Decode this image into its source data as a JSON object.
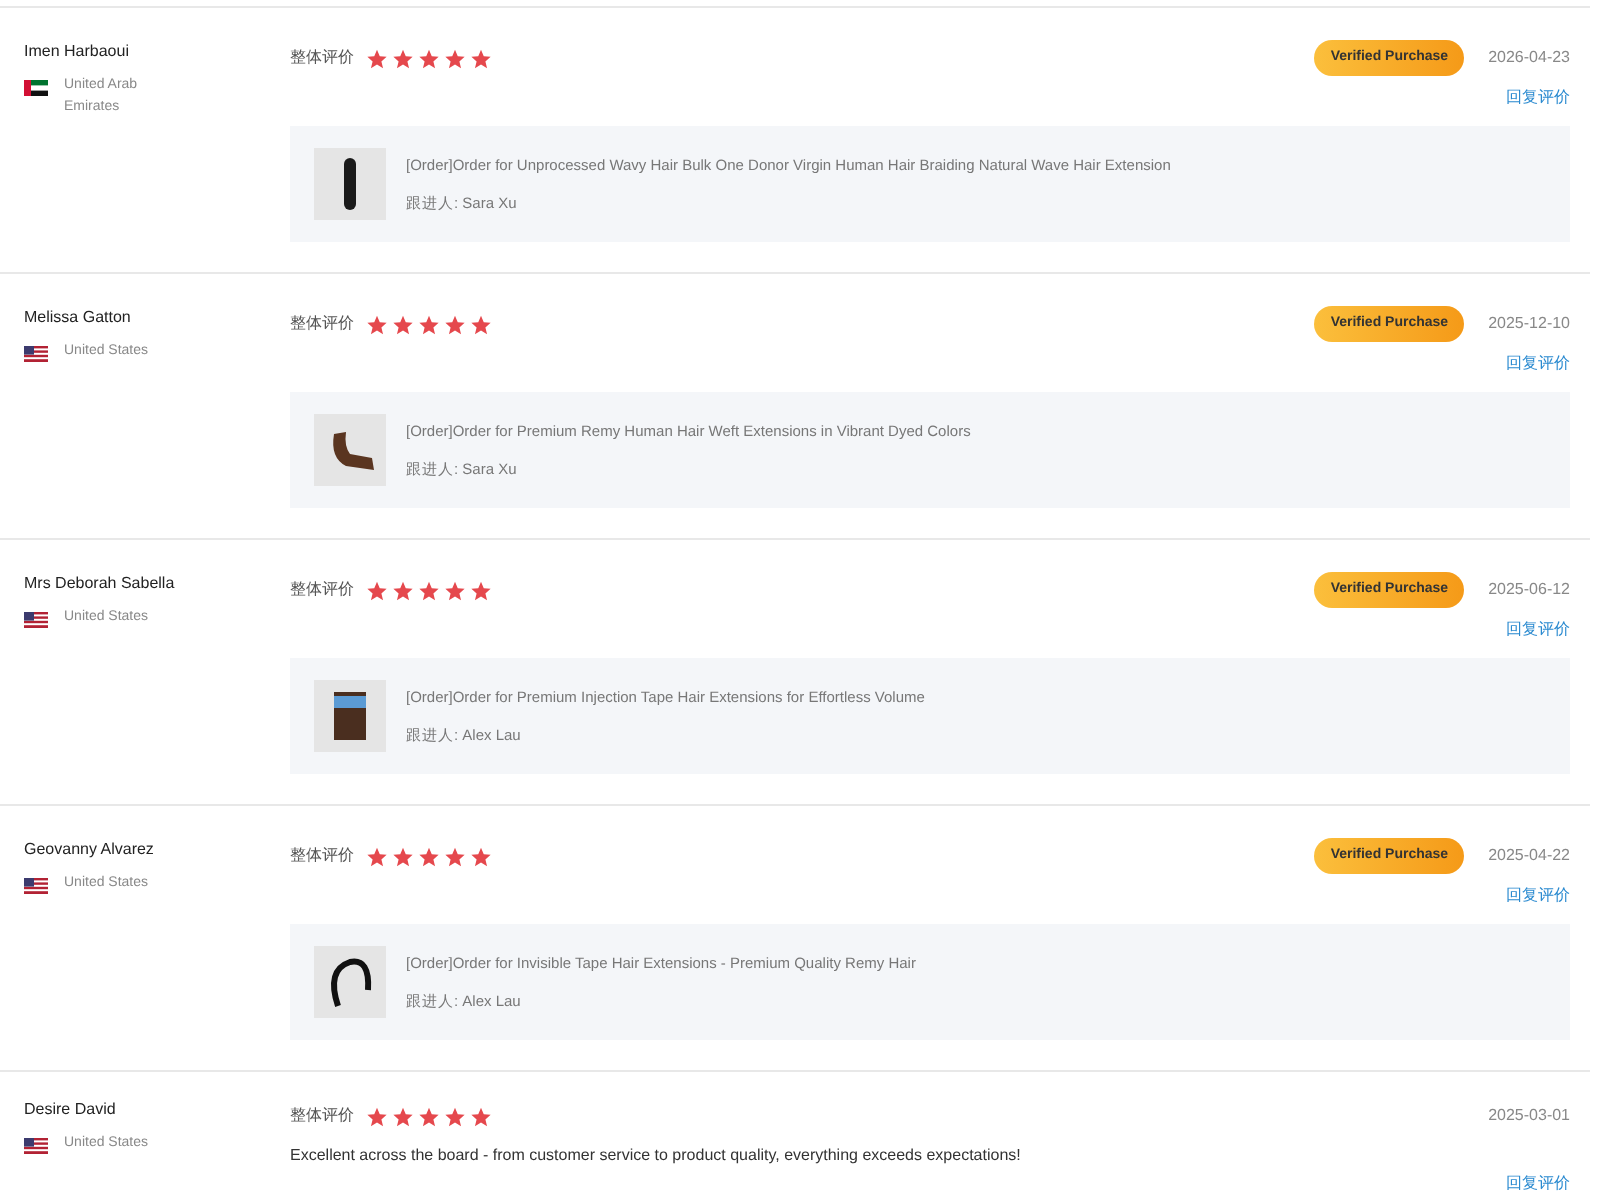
{
  "reviews": [
    {
      "name": "Imen Harbaoui",
      "kind": "ae",
      "country": "United Arab Emirates",
      "rating_label": "整体评价",
      "stars": 5,
      "badge": "Verified Purchase",
      "date": "2026-04-23",
      "reply": "回复评价",
      "order": {
        "title": "[Order]Order for Unprocessed Wavy Hair Bulk One Donor Virgin Human Hair Braiding Natural Wave Hair Extension",
        "follower": "跟进人: Sara Xu"
      }
    },
    {
      "name": "Melissa Gatton",
      "kind": "us",
      "country": "United States",
      "rating_label": "整体评价",
      "stars": 5,
      "badge": "Verified Purchase",
      "date": "2025-12-10",
      "reply": "回复评价",
      "order": {
        "title": "[Order]Order for Premium Remy Human Hair Weft Extensions in Vibrant Dyed Colors",
        "follower": "跟进人: Sara Xu"
      }
    },
    {
      "name": "Mrs Deborah Sabella",
      "kind": "us",
      "country": "United States",
      "rating_label": "整体评价",
      "stars": 5,
      "badge": "Verified Purchase",
      "date": "2025-06-12",
      "reply": "回复评价",
      "order": {
        "title": "[Order]Order for Premium Injection Tape Hair Extensions for Effortless Volume",
        "follower": "跟进人: Alex Lau"
      }
    },
    {
      "name": "Geovanny Alvarez",
      "kind": "us",
      "country": "United States",
      "rating_label": "整体评价",
      "stars": 5,
      "badge": "Verified Purchase",
      "date": "2025-04-22",
      "reply": "回复评价",
      "order": {
        "title": "[Order]Order for Invisible Tape Hair Extensions - Premium Quality Remy Hair",
        "follower": "跟进人: Alex Lau"
      }
    },
    {
      "name": "Desire David",
      "kind": "us",
      "country": "United States",
      "rating_label": "整体评价",
      "stars": 5,
      "date": "2025-03-01",
      "comment": "Excellent across the board - from customer service to product quality, everything exceeds expectations!",
      "reply": "回复评价"
    }
  ]
}
